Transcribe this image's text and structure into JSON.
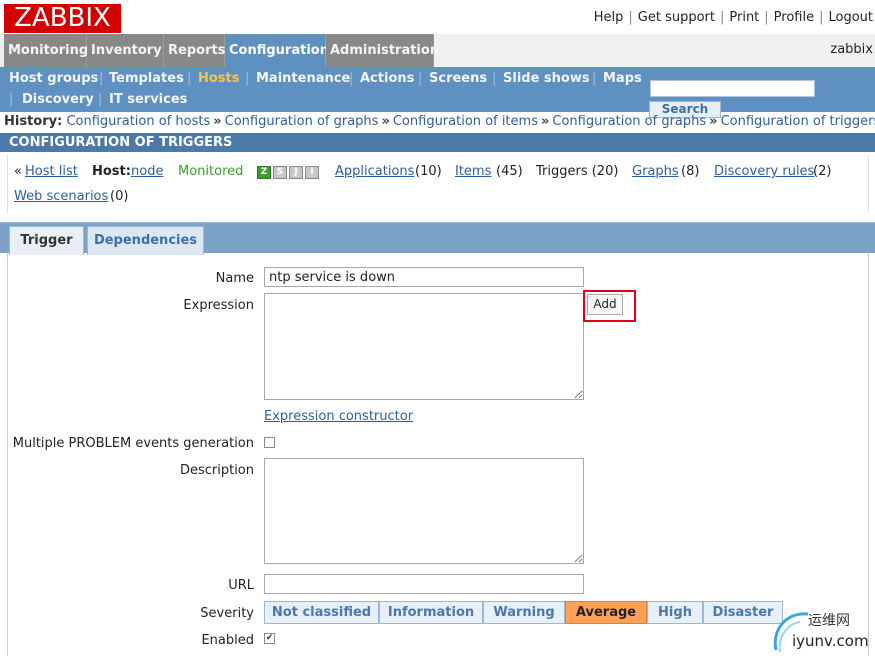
{
  "header": {
    "logo": "ZABBIX",
    "links": [
      "Help",
      "Get support",
      "Print",
      "Profile",
      "Logout"
    ],
    "username": "zabbix"
  },
  "main_menu": [
    "Monitoring",
    "Inventory",
    "Reports",
    "Configuration",
    "Administration"
  ],
  "main_menu_active": "Configuration",
  "sub_menu": [
    "Host groups",
    "Templates",
    "Hosts",
    "Maintenance",
    "Actions",
    "Screens",
    "Slide shows",
    "Maps",
    "Discovery",
    "IT services"
  ],
  "sub_menu_active": "Hosts",
  "search": {
    "value": "",
    "button": "Search"
  },
  "history": {
    "label": "History:",
    "items": [
      "Configuration of hosts",
      "Configuration of graphs",
      "Configuration of items",
      "Configuration of graphs",
      "Configuration of triggers"
    ],
    "separator": "»"
  },
  "section_title": "CONFIGURATION OF TRIGGERS",
  "host_bar": {
    "prefix": "«",
    "host_list": "Host list",
    "host_label": "Host:",
    "host_name": "node",
    "status": "Monitored",
    "availability": [
      "Z",
      "S",
      "J",
      "I"
    ],
    "applications": "Applications",
    "applications_count": "(10)",
    "items": "Items",
    "items_count": "(45)",
    "triggers": "Triggers (20)",
    "graphs": "Graphs",
    "graphs_count": "(8)",
    "discovery": "Discovery rules",
    "discovery_count": "(2)",
    "web": "Web scenarios",
    "web_count": "(0)"
  },
  "tabs": [
    "Trigger",
    "Dependencies"
  ],
  "form": {
    "name_label": "Name",
    "name_value": "ntp service is down",
    "expression_label": "Expression",
    "expression_value": "",
    "add_button": "Add",
    "expression_constructor": "Expression constructor",
    "multiple_label": "Multiple PROBLEM events generation",
    "multiple_checked": false,
    "description_label": "Description",
    "description_value": "",
    "url_label": "URL",
    "url_value": "",
    "severity_label": "Severity",
    "severity_options": [
      "Not classified",
      "Information",
      "Warning",
      "Average",
      "High",
      "Disaster"
    ],
    "severity_selected": "Average",
    "enabled_label": "Enabled",
    "enabled_checked": true,
    "check_mark": "✔"
  },
  "colors": {
    "logo_red": "#d40000",
    "menu_blue": "#5f91c0",
    "active_submenu": "#f6c743",
    "severity_average": "#ffa059",
    "highlight_red": "#e2001a"
  },
  "watermark": {
    "text": "运维网",
    "sub": "iyunv.com"
  }
}
